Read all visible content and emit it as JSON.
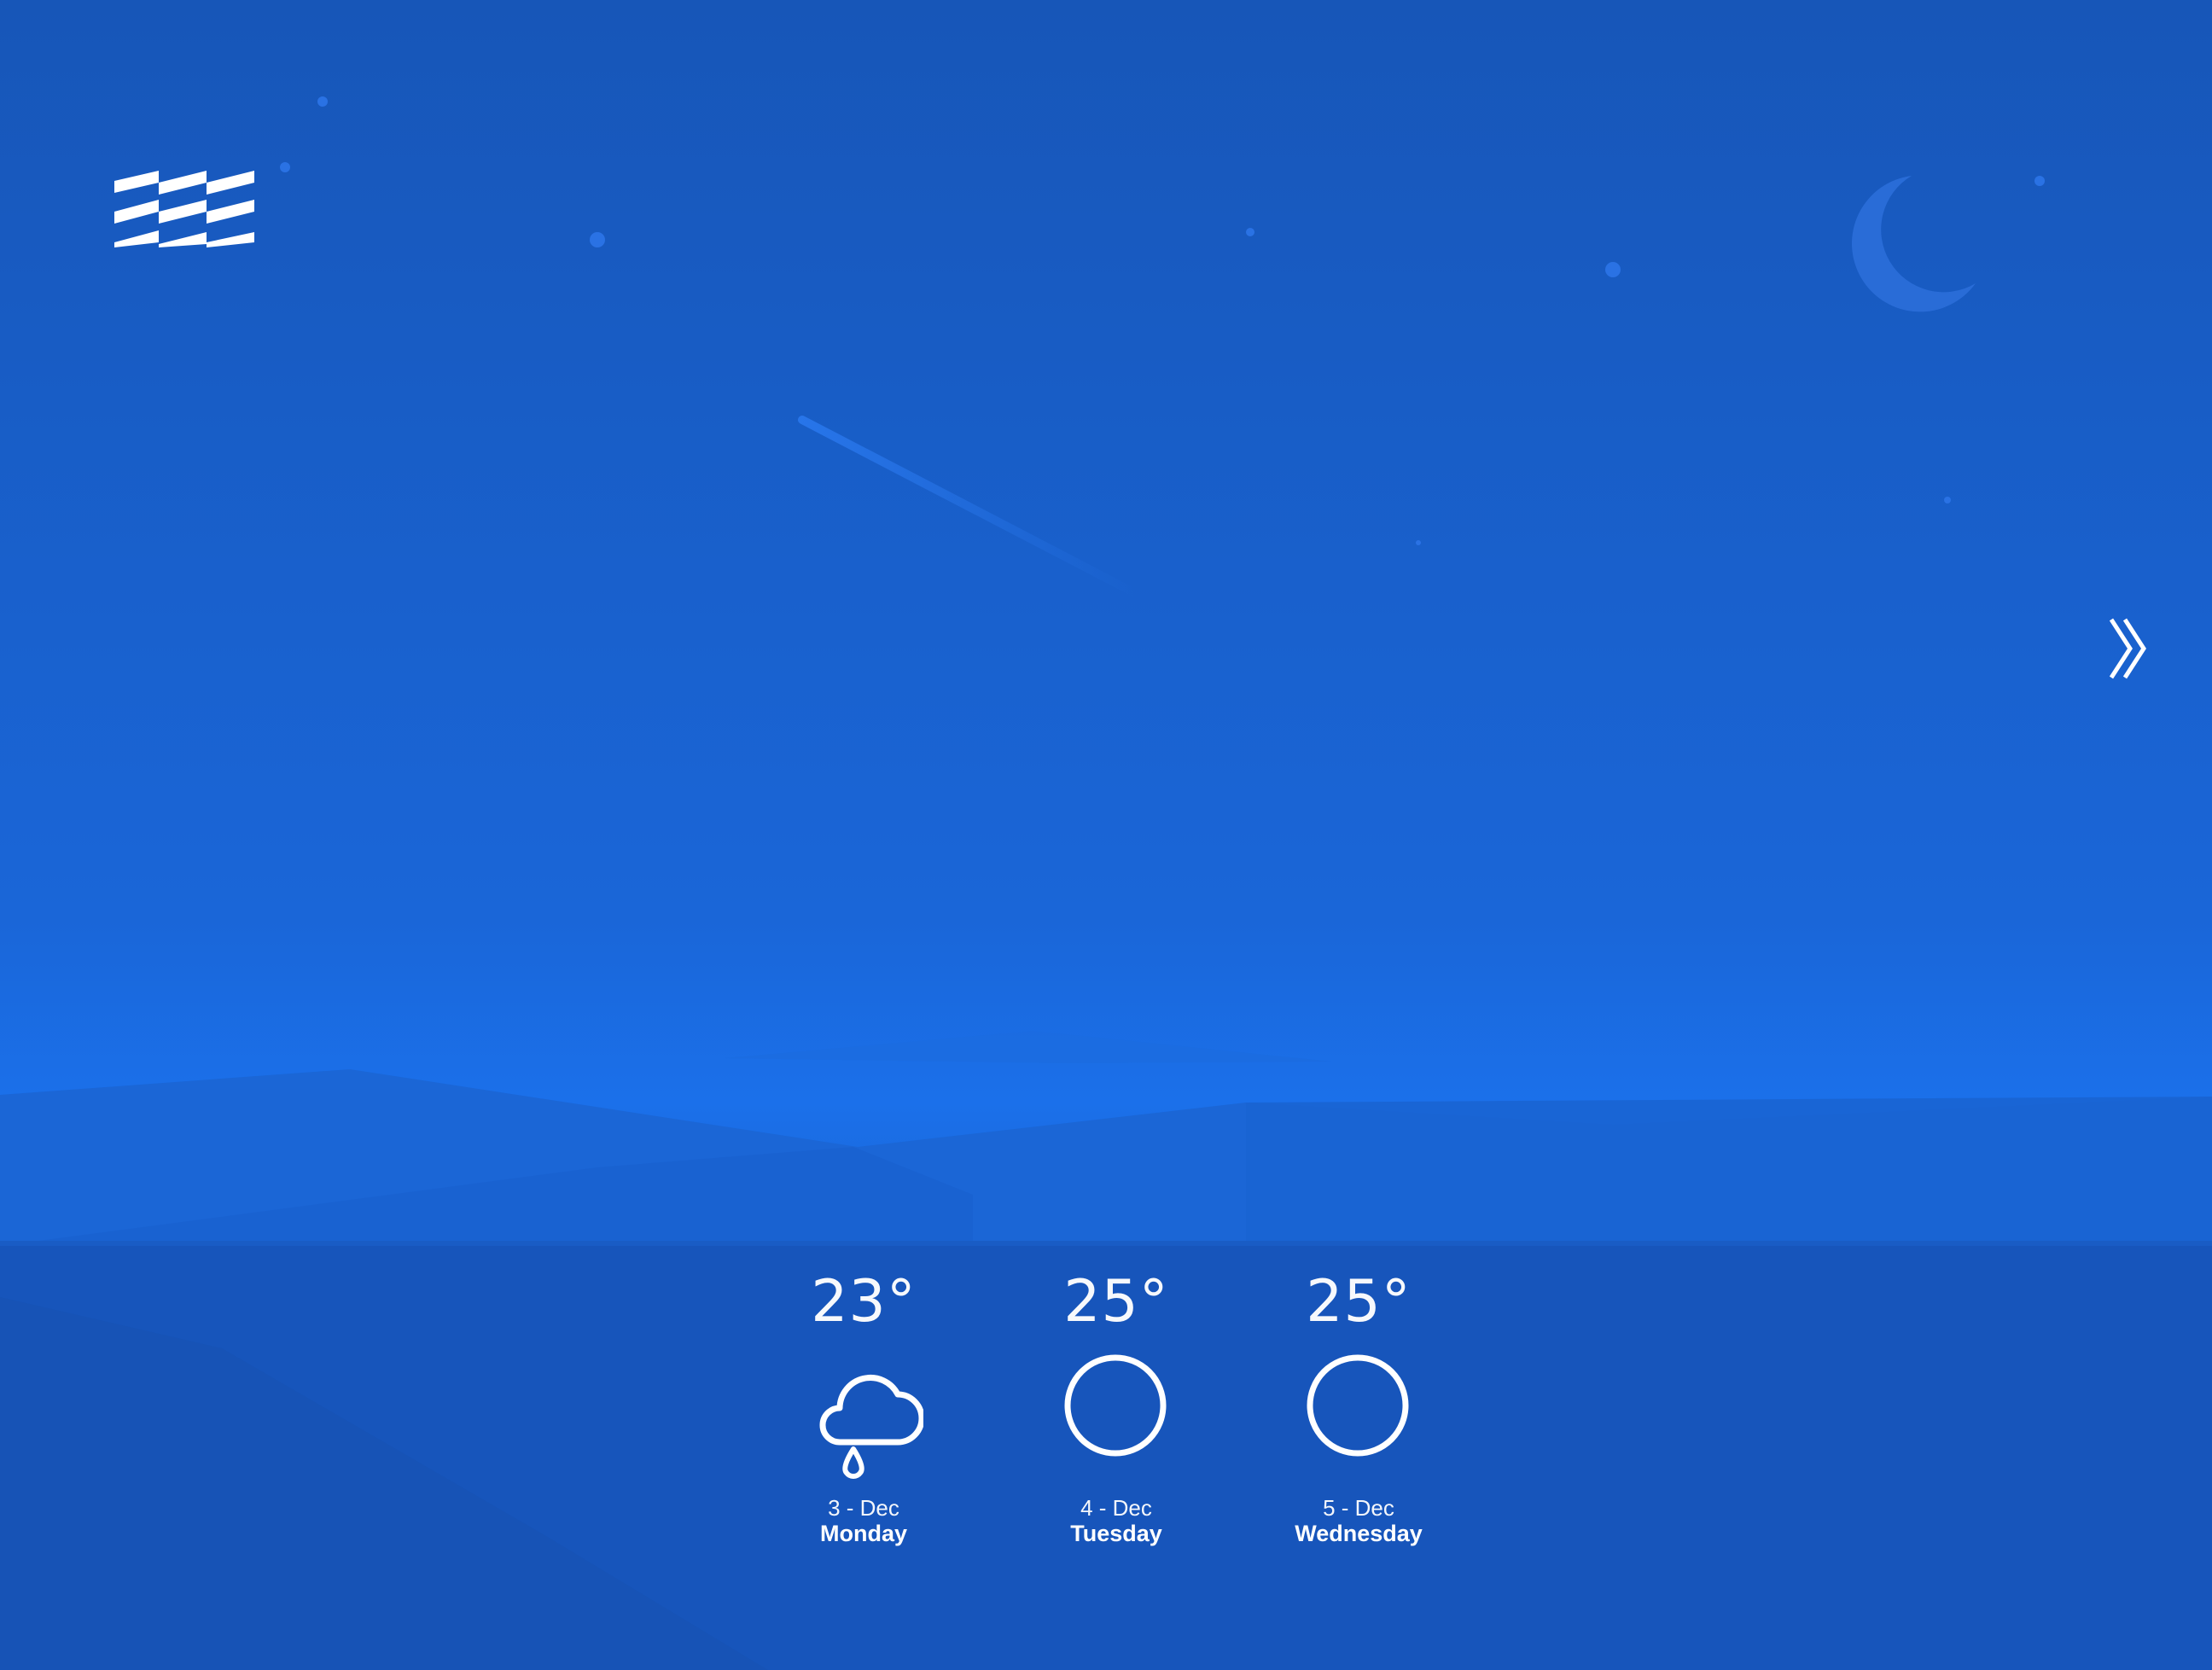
{
  "colors": {
    "sky_top": "#1756b8",
    "sky_horizon": "#1b70ea",
    "ground": "#1854bb",
    "foreground": "#ffffff"
  },
  "header": {
    "logo_icon": "striped-flag-logo-icon"
  },
  "navigation": {
    "next_icon": "double-chevron-right-icon"
  },
  "scene": {
    "moon_icon": "crescent-moon-icon",
    "shooting_star_icon": "shooting-star-icon"
  },
  "forecast": [
    {
      "temp": "23°",
      "date": "3 - Dec",
      "day": "Monday",
      "icon": "rain-cloud-icon"
    },
    {
      "temp": "25°",
      "date": "4 - Dec",
      "day": "Tuesday",
      "icon": "sun-circle-icon"
    },
    {
      "temp": "25°",
      "date": "5 - Dec",
      "day": "Wednesday",
      "icon": "sun-circle-icon"
    }
  ]
}
